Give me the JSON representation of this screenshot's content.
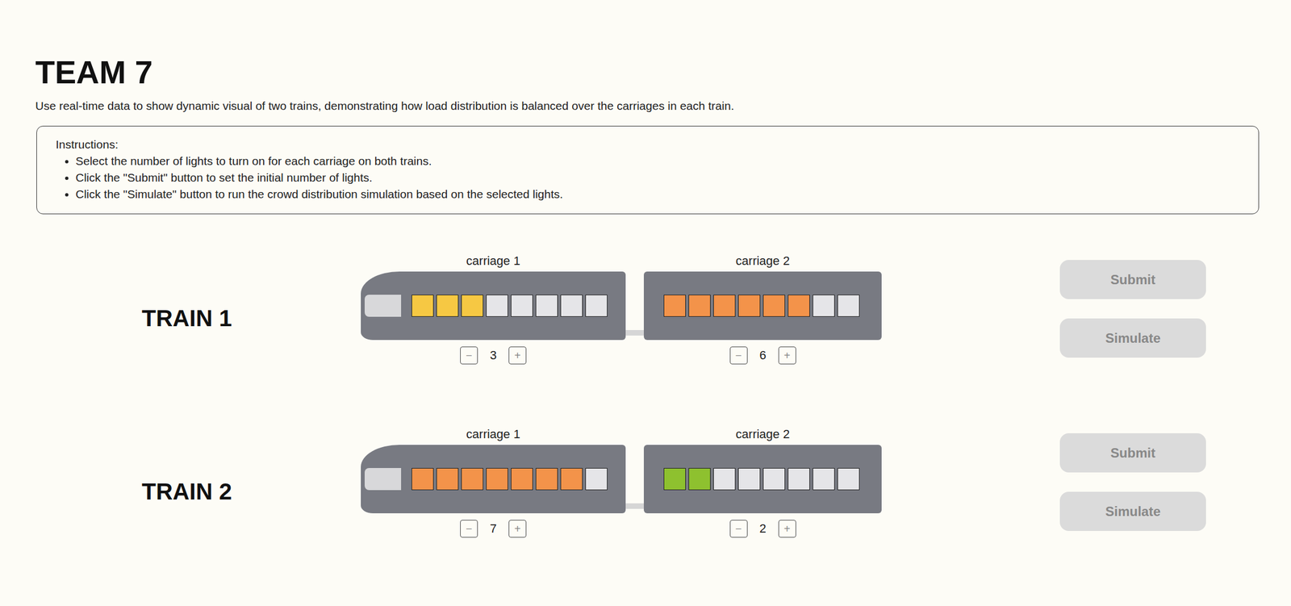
{
  "header": {
    "title": "TEAM 7",
    "description": "Use real-time data to show dynamic visual of two trains, demonstrating how load distribution is balanced over the carriages in each train."
  },
  "instructions": {
    "heading": "Instructions:",
    "items": [
      "Select the number of lights to turn on for each carriage on both trains.",
      "Click the \"Submit\" button to set the initial number of lights.",
      "Click the \"Simulate\" button to run the crowd distribution simulation based on the selected lights."
    ]
  },
  "trains": [
    {
      "name": "TRAIN 1",
      "carriages": [
        {
          "label": "carriage 1",
          "kind": "front",
          "count": "3",
          "decrement": "−",
          "increment": "+",
          "color": "#f6c843",
          "lights": [
            true,
            true,
            true,
            false,
            false,
            false,
            false,
            false
          ]
        },
        {
          "label": "carriage 2",
          "kind": "car",
          "count": "6",
          "decrement": "−",
          "increment": "+",
          "color": "#f3934a",
          "lights": [
            true,
            true,
            true,
            true,
            true,
            true,
            false,
            false
          ]
        }
      ],
      "buttons": [
        {
          "label": "Submit",
          "disabled": true
        },
        {
          "label": "Simulate",
          "disabled": true
        }
      ]
    },
    {
      "name": "TRAIN 2",
      "carriages": [
        {
          "label": "carriage 1",
          "kind": "front",
          "count": "7",
          "decrement": "−",
          "increment": "+",
          "color": "#f3934a",
          "lights": [
            true,
            true,
            true,
            true,
            true,
            true,
            true,
            false
          ]
        },
        {
          "label": "carriage 2",
          "kind": "car",
          "count": "2",
          "decrement": "−",
          "increment": "+",
          "color": "#8ec12f",
          "lights": [
            true,
            true,
            false,
            false,
            false,
            false,
            false,
            false
          ]
        }
      ],
      "buttons": [
        {
          "label": "Submit",
          "disabled": true
        },
        {
          "label": "Simulate",
          "disabled": true
        }
      ]
    }
  ]
}
